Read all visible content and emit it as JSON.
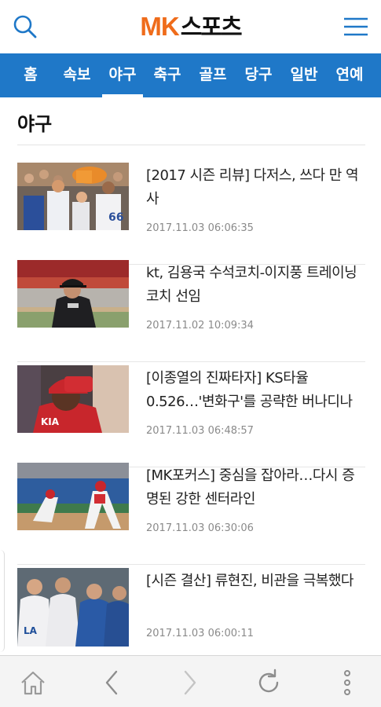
{
  "header": {
    "logo_mk": "MK",
    "logo_sports": "스포츠",
    "search_icon": "search-icon",
    "menu_icon": "hamburger-menu-icon",
    "accent_color": "#1f78c8",
    "logo_color": "#ef6c1b"
  },
  "categories": [
    {
      "label": "홈",
      "active": false
    },
    {
      "label": "속보",
      "active": false
    },
    {
      "label": "야구",
      "active": true
    },
    {
      "label": "축구",
      "active": false
    },
    {
      "label": "골프",
      "active": false
    },
    {
      "label": "당구",
      "active": false
    },
    {
      "label": "일반",
      "active": false
    },
    {
      "label": "연예",
      "active": false
    }
  ],
  "section": {
    "title": "야구"
  },
  "articles": [
    {
      "headline": "[2017 시즌 리뷰] 다저스, 쓰다 만 역사",
      "date": "2017.11.03 06:06:35"
    },
    {
      "headline": "kt, 김용국 수석코치-이지풍 트레이닝코치 선임",
      "date": "2017.11.02 10:09:34"
    },
    {
      "headline": "[이종열의 진짜타자] KS타율 0.526…'변화구'를 공략한 버나디나",
      "date": "2017.11.03 06:48:57"
    },
    {
      "headline": "[MK포커스] 중심을 잡아라…다시 증명된 강한 센터라인",
      "date": "2017.11.03 06:30:06"
    },
    {
      "headline": "[시즌 결산] 류현진, 비관을 극복했다",
      "date": "2017.11.03 06:00:11"
    }
  ],
  "browser_bar": {
    "home_icon": "home-icon",
    "back_icon": "back-arrow-icon",
    "forward_icon": "forward-arrow-icon",
    "refresh_icon": "refresh-icon",
    "more_icon": "more-vertical-icon"
  }
}
